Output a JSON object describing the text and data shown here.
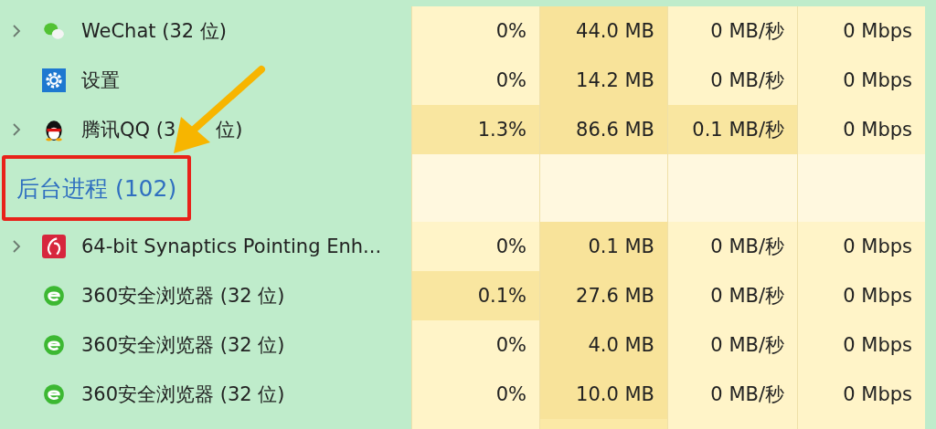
{
  "sections": [
    {
      "kind": "apps",
      "rows": [
        {
          "name": "WeChat (32 位)",
          "kind": "wechat",
          "expandable": true,
          "cells": [
            {
              "value": "0%",
              "hot": false
            },
            {
              "value": "44.0 MB",
              "hot": true
            },
            {
              "value": "0 MB/秒",
              "hot": false
            },
            {
              "value": "0 Mbps",
              "hot": false
            }
          ]
        },
        {
          "name": "设置",
          "kind": "settings",
          "expandable": false,
          "cells": [
            {
              "value": "0%",
              "hot": false
            },
            {
              "value": "14.2 MB",
              "hot": true
            },
            {
              "value": "0 MB/秒",
              "hot": false
            },
            {
              "value": "0 Mbps",
              "hot": false
            }
          ]
        },
        {
          "name": "腾讯QQ (3",
          "name_rest": "位)",
          "kind": "qq",
          "expandable": true,
          "cells": [
            {
              "value": "1.3%",
              "hot": true
            },
            {
              "value": "86.6 MB",
              "hot": true
            },
            {
              "value": "0.1 MB/秒",
              "hot": true
            },
            {
              "value": "0 Mbps",
              "hot": false
            }
          ]
        }
      ]
    },
    {
      "kind": "background",
      "title": "后台进程 (102)",
      "highlighted": true,
      "rows": [
        {
          "name": "64-bit Synaptics Pointing Enh...",
          "kind": "synaptics",
          "expandable": true,
          "cells": [
            {
              "value": "0%",
              "hot": false
            },
            {
              "value": "0.1 MB",
              "hot": true
            },
            {
              "value": "0 MB/秒",
              "hot": false
            },
            {
              "value": "0 Mbps",
              "hot": false
            }
          ]
        },
        {
          "name": "360安全浏览器 (32 位)",
          "kind": "browser",
          "expandable": false,
          "cells": [
            {
              "value": "0.1%",
              "hot": true
            },
            {
              "value": "27.6 MB",
              "hot": true
            },
            {
              "value": "0 MB/秒",
              "hot": false
            },
            {
              "value": "0 Mbps",
              "hot": false
            }
          ]
        },
        {
          "name": "360安全浏览器 (32 位)",
          "kind": "browser",
          "expandable": false,
          "cells": [
            {
              "value": "0%",
              "hot": false
            },
            {
              "value": "4.0 MB",
              "hot": true
            },
            {
              "value": "0 MB/秒",
              "hot": false
            },
            {
              "value": "0 Mbps",
              "hot": false
            }
          ]
        },
        {
          "name": "360安全浏览器 (32 位)",
          "kind": "browser",
          "expandable": false,
          "cells": [
            {
              "value": "0%",
              "hot": false
            },
            {
              "value": "10.0 MB",
              "hot": true
            },
            {
              "value": "0 MB/秒",
              "hot": false
            },
            {
              "value": "0 Mbps",
              "hot": false
            }
          ]
        }
      ]
    }
  ],
  "annotation": {
    "kind": "arrow"
  }
}
